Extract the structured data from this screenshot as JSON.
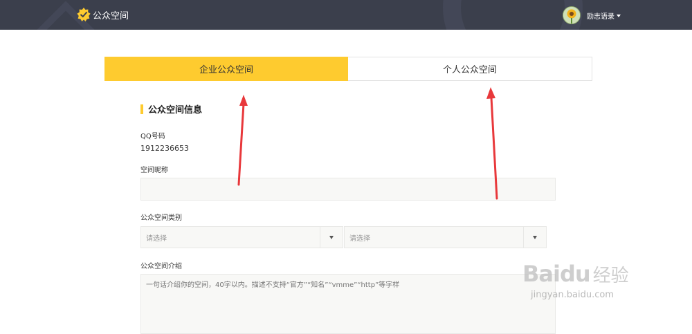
{
  "header": {
    "logo_text": "公众空间",
    "user_name": "励志语录",
    "icons": {
      "logo": "checkmark-star-icon",
      "avatar": "sunflower-avatar",
      "caret": "caret-down-icon"
    }
  },
  "tabs": [
    {
      "label": "企业公众空间",
      "active": true
    },
    {
      "label": "个人公众空间",
      "active": false
    }
  ],
  "section": {
    "title": "公众空间信息"
  },
  "qq": {
    "label": "QQ号码",
    "value": "1912236653"
  },
  "nickname": {
    "label": "空间昵称",
    "value": "",
    "placeholder": ""
  },
  "category": {
    "label": "公众空间类别",
    "select1": {
      "value": "请选择"
    },
    "select2": {
      "value": "请选择"
    }
  },
  "intro": {
    "label": "公众空间介绍",
    "placeholder": "一句话介绍你的空间，40字以内。描述不支持“官方”“知名”“vmme”“http”等字样"
  },
  "watermark": {
    "main": "Baidu",
    "cn": "经验",
    "sub": "jingyan.baidu.com"
  },
  "colors": {
    "accent": "#fecb2f",
    "header_bg": "#3b3f4c",
    "arrow": "#e8383b"
  }
}
